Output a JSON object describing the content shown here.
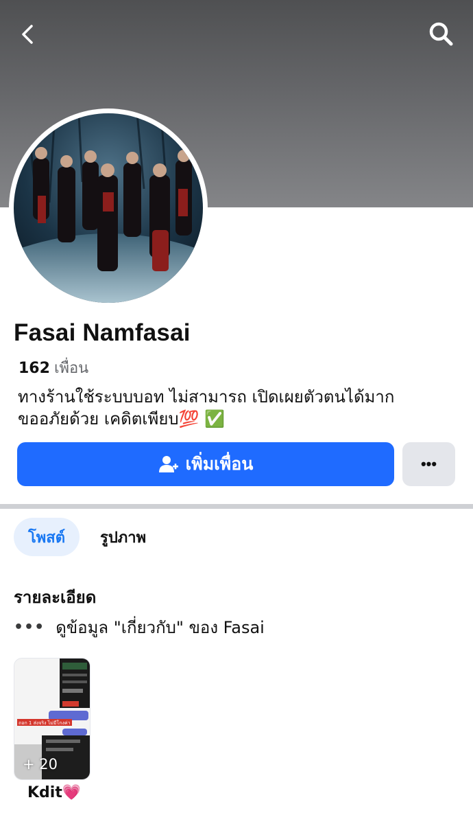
{
  "profile": {
    "name": "Fasai Namfasai",
    "friends_count": "162",
    "friends_label": "เพื่อน",
    "bio_line1": "ทางร้านใช้ระบบบอท ไม่สามารถ เปิดเผยตัวตนได้มาก",
    "bio_line2": "ขออภัยด้วย เคดิตเพียบ💯 ✅"
  },
  "actions": {
    "add_friend_label": "เพิ่มเพื่อน",
    "more_label": "•••"
  },
  "tabs": [
    {
      "label": "โพสต์",
      "active": true
    },
    {
      "label": "รูปภาพ",
      "active": false
    }
  ],
  "details": {
    "title": "รายละเอียด",
    "about_dots": "•••",
    "about_text": "ดูข้อมูล \"เกี่ยวกับ\" ของ Fasai"
  },
  "album": {
    "count": "+ 20",
    "label": "Kdit💗",
    "overlay_text": "ถอก 1 ส่งจริง ไม่มีโกงค่า"
  },
  "icons": {
    "back": "chevron-left-icon",
    "search": "search-icon",
    "add_friend": "add-person-icon"
  },
  "colors": {
    "primary": "#1f6bff",
    "tab_active_bg": "#e7f0fd",
    "tab_active_text": "#1877f2",
    "secondary_button": "#e4e6eb"
  }
}
